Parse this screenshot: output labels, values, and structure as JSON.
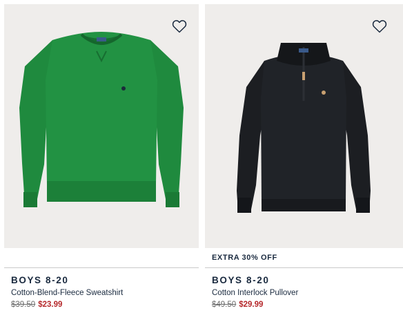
{
  "products": [
    {
      "promo": "",
      "category": "BOYS 8-20",
      "name": "Cotton-Blend-Fleece Sweatshirt",
      "original_price": "$39.50",
      "sale_price": "$23.99",
      "garment_color": "#1f8a3e",
      "wishlist_icon": "heart-outline-icon"
    },
    {
      "promo": "EXTRA 30% OFF",
      "category": "BOYS 8-20",
      "name": "Cotton Interlock Pullover",
      "original_price": "$49.50",
      "sale_price": "$29.99",
      "garment_color": "#16181c",
      "wishlist_icon": "heart-outline-icon"
    }
  ],
  "colors": {
    "image_background": "#efedeb",
    "text": "#1a2a3f",
    "sale_price": "#b5282b",
    "original_price": "#6b6b6b",
    "divider": "#c9c9c9"
  }
}
